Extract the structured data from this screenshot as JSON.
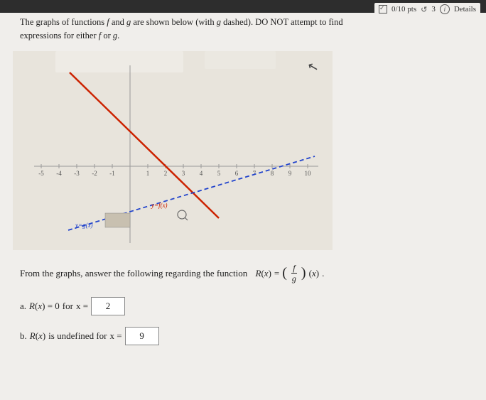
{
  "topBar": {},
  "score": {
    "points": "0/10 pts",
    "retries": "3",
    "details_label": "Details"
  },
  "header": {
    "line1": "The graphs of functions",
    "f_label": "f",
    "and_label": "and",
    "g_label": "g",
    "line2_part1": "are shown below (with",
    "g_label2": "g",
    "dashed_label": "dashed).",
    "do_not": "DO NOT attempt to find",
    "expressions_for_either": "expressions for either",
    "f_label2": "f",
    "or_label": "or",
    "g_label3": "g",
    "period": "."
  },
  "graph": {
    "x_min": -5,
    "x_max": 10,
    "y_min": -4,
    "y_max": 6,
    "x_ticks": [
      -5,
      -4,
      -3,
      -2,
      -1,
      1,
      2,
      3,
      4,
      5,
      6,
      7,
      8,
      9,
      10
    ],
    "y_label_g": "y=g(x)",
    "y_label_f": "y=f(x)"
  },
  "main": {
    "from_graphs_text": "From the graphs, answer the following regarding the function",
    "R_label": "R(x)",
    "equals": "=",
    "frac_num": "f",
    "frac_den": "g",
    "x_arg": "(x)",
    "period": ".",
    "part_a": {
      "label": "a.",
      "equation": "R(x) = 0",
      "for_text": "for",
      "x_label": "x =",
      "answer": "2"
    },
    "part_b": {
      "label": "b.",
      "equation": "R(x)",
      "is_undefined_text": "is undefined for",
      "x_label": "x =",
      "answer": "9"
    }
  }
}
